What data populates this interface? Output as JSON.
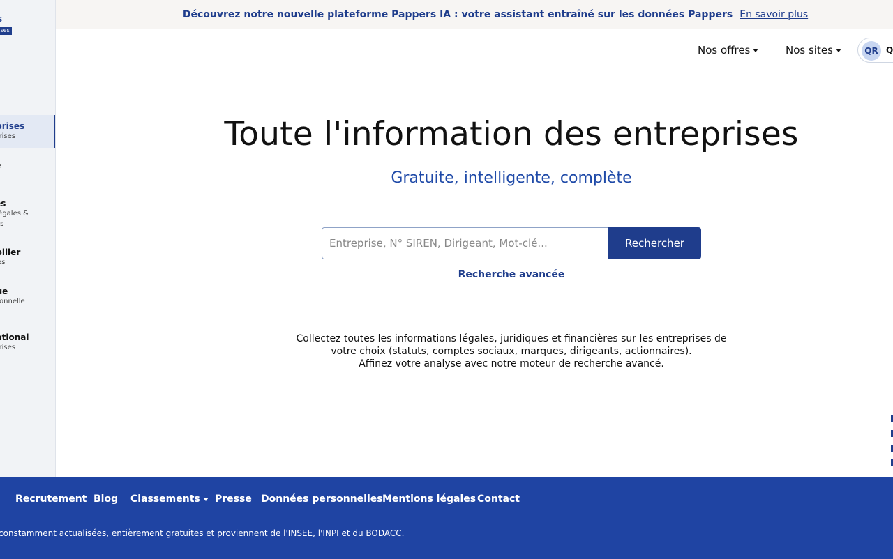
{
  "sidebar": {
    "logo_text": "s",
    "logo_badge": "rises",
    "items": [
      {
        "title": "eprises",
        "sub": [
          "eprises"
        ]
      },
      {
        "title": "ce",
        "sub": [
          "ce"
        ]
      },
      {
        "title": "ces",
        "sub": [
          "s légales &",
          "ises"
        ]
      },
      {
        "title": "obilier",
        "sub": [
          "ères"
        ]
      },
      {
        "title": "que",
        "sub": [
          "utionnelle"
        ]
      },
      {
        "title": "national",
        "sub": [
          "eprises"
        ]
      }
    ]
  },
  "banner": {
    "text": "Découvrez notre nouvelle plateforme Pappers IA : votre assistant entraîné sur les données Pappers",
    "link": "En savoir plus"
  },
  "nav": {
    "offers": "Nos offres",
    "sites": "Nos sites",
    "avatar_initials": "QR",
    "user_initial": "Q"
  },
  "hero": {
    "title": "Toute l'information des entreprises",
    "subtitle": "Gratuite, intelligente, complète"
  },
  "search": {
    "placeholder": "Entreprise, N° SIREN, Dirigeant, Mot-clé...",
    "button": "Rechercher",
    "advanced": "Recherche avancée"
  },
  "description": {
    "line1": "Collectez toutes les informations légales, juridiques et financières sur les entreprises de",
    "line2": "votre choix (statuts, comptes sociaux, marques, dirigeants, actionnaires).",
    "line3": "Affinez votre analyse avec notre moteur de recherche avancé."
  },
  "footer": {
    "links": [
      "Recrutement",
      "Blog",
      "Classements",
      "Presse",
      "Données personnelles",
      "Mentions légales",
      "Contact"
    ],
    "note": "constamment actualisées, entièrement gratuites et proviennent de l'INSEE, l'INPI et du BODACC."
  },
  "colors": {
    "brand": "#1f3d8c",
    "footer": "#1f44a3",
    "subtitle": "#1f4aa8"
  }
}
